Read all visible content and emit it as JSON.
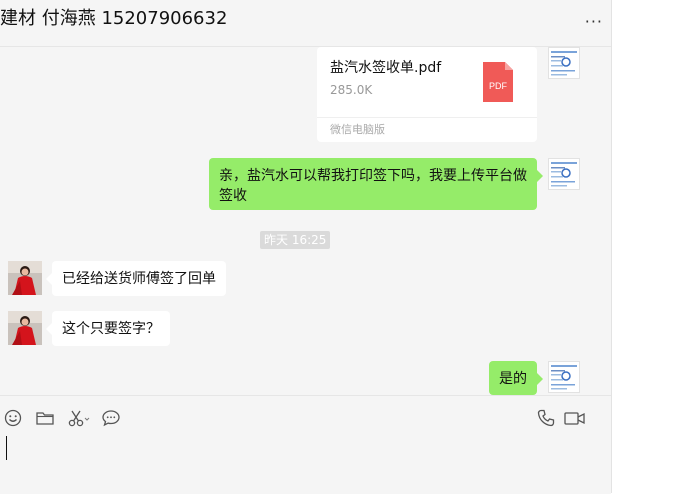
{
  "header": {
    "title": "建材 付海燕 15207906632",
    "more_label": "···"
  },
  "messages": [
    {
      "type": "file",
      "side": "right",
      "file_name": "盐汽水签收单.pdf",
      "file_size": "285.0K",
      "source": "微信电脑版",
      "icon_label": "PDF"
    },
    {
      "type": "text",
      "side": "right",
      "text": "亲，盐汽水可以帮我打印签下吗，我要上传平台做签收"
    },
    {
      "type": "timestamp",
      "text": "昨天 16:25"
    },
    {
      "type": "text",
      "side": "left",
      "text": "已经给送货师傅签了回单"
    },
    {
      "type": "text",
      "side": "left",
      "text": "这个只要签字？"
    },
    {
      "type": "text",
      "side": "right",
      "text": "是的"
    }
  ],
  "toolbar": {
    "left": [
      "emoji-icon",
      "folder-icon",
      "scissors-icon",
      "chat-bubble-icon"
    ],
    "right": [
      "phone-icon",
      "video-icon"
    ]
  },
  "colors": {
    "self_bubble": "#95ec69",
    "other_bubble": "#ffffff",
    "background": "#f5f5f5",
    "pdf_icon": "#f05a57"
  }
}
